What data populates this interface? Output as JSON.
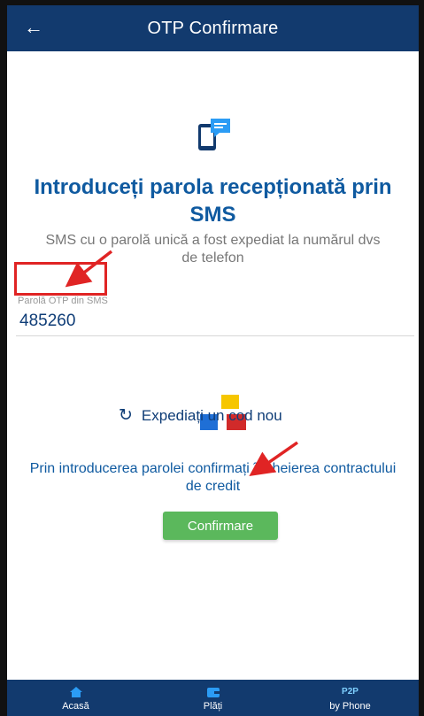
{
  "appbar": {
    "back_icon": "arrow-left-icon",
    "title": "OTP Confirmare"
  },
  "main": {
    "icon": "phone-sms-icon",
    "heading": "Introduceți parola recepționată prin SMS",
    "subtext": "SMS cu o parolă unică a fost expediat la numărul dvs de telefon",
    "otp_field": {
      "label": "Parolă OTP din SMS",
      "value": "485260"
    },
    "resend": {
      "icon": "refresh-icon",
      "label": "Expediați un cod nou"
    },
    "notice": "Prin introducerea parolei confirmați încheierea contractului de credit",
    "confirm_label": "Confirmare"
  },
  "bottom_nav": {
    "items": [
      {
        "label": "Acasă",
        "icon": "home-icon"
      },
      {
        "label": "Plăți",
        "icon": "wallet-icon"
      },
      {
        "label": "by Phone",
        "icon": "p2p-icon",
        "icon_text": "P2P"
      }
    ]
  },
  "colors": {
    "appbar": "#123a6e",
    "heading": "#0f5aa0",
    "button": "#5bb85c",
    "annotation": "#e02424"
  }
}
